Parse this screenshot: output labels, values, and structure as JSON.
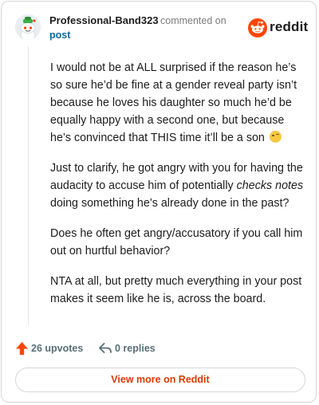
{
  "header": {
    "username": "Professional-Band323",
    "commented_on": "commented on",
    "post_link": "post",
    "brand": "reddit"
  },
  "comment": {
    "paragraphs": [
      "I would not be at ALL surprised if the reason he’s so sure he’d be fine at a gender reveal party isn’t because he loves his daughter so much he’d be equally happy with a second one, but because he’s convinced that THIS time it’ll be a son",
      {
        "before": "Just to clarify, he got angry with you for having the audacity to accuse him of potentially ",
        "italic": "checks notes",
        "after": " doing something he’s already done in the past?"
      },
      "Does he often get angry/accusatory if you call him out on hurtful behavior?",
      "NTA at all, but pretty much everything in your post makes it seem like he is, across the board."
    ]
  },
  "actions": {
    "upvotes": "26 upvotes",
    "replies": "0 replies"
  },
  "footer": {
    "view_more": "View more on Reddit"
  },
  "colors": {
    "brand": "#ff4500",
    "link": "#0a6a9e",
    "muted": "#7c7c7c",
    "action": "#576f76",
    "view_more_text": "#d93a00"
  },
  "icons": {
    "avatar": "snoo-avatar",
    "logo": "reddit-logo-icon",
    "upvote": "upvote-arrow-icon",
    "reply": "reply-icon",
    "emoji": "smirk-emoji"
  }
}
